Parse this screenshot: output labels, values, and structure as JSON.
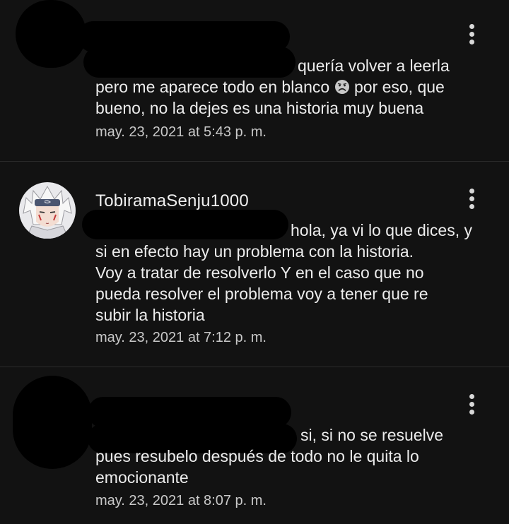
{
  "comments": [
    {
      "username": "",
      "lines": [
        "querí­a volver a leerla",
        "pero me aparece todo en blanco",
        "por eso, que",
        "bueno, no la dejes es una historia muy buena"
      ],
      "timestamp": "may. 23, 2021 at 5:43 p. m.",
      "emoji": "sad-face-icon"
    },
    {
      "username": "TobiramaSenju1000",
      "lines": [
        "hola, ya vi lo que dices, y",
        "si en efecto hay un problema con la historia.",
        "Voy a tratar de resolverlo Y en el caso que no",
        "pueda resolver el problema voy a tener que re",
        "subir la historia"
      ],
      "timestamp": "may. 23, 2021 at 7:12 p. m."
    },
    {
      "username": "",
      "lines": [
        "si, si no se resuelve",
        "pues resubelo después de todo no le quita lo",
        "emocionante"
      ],
      "timestamp": "may. 23, 2021 at 8:07 p. m."
    }
  ],
  "colors": {
    "background": "#121212",
    "text": "#ececec",
    "timestamp": "#c9c9c9",
    "divider": "#2a2a2a",
    "redaction": "#000000"
  }
}
